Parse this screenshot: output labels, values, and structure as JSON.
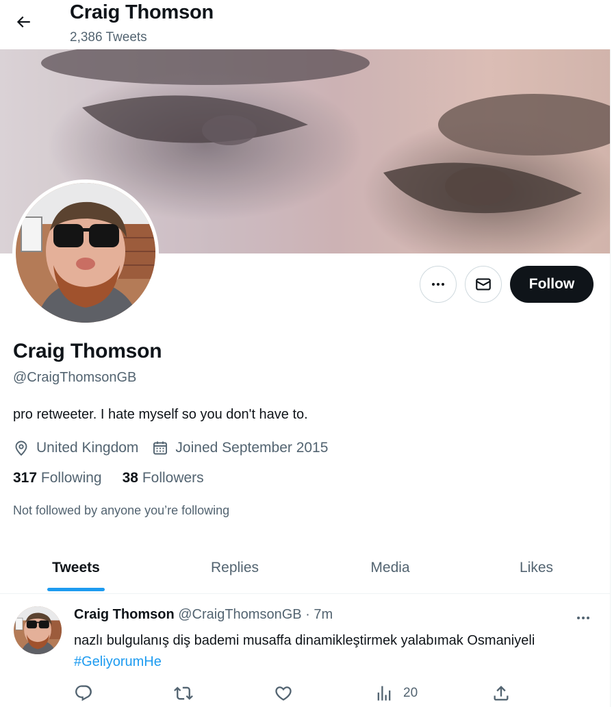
{
  "header": {
    "title": "Craig Thomson",
    "tweet_count": "2,386 Tweets"
  },
  "profile": {
    "display_name": "Craig Thomson",
    "handle": "@CraigThomsonGB",
    "bio": "pro retweeter. I hate myself so you don't have to.",
    "location": "United Kingdom",
    "joined": "Joined September 2015",
    "following_count": "317",
    "following_label": "Following",
    "followers_count": "38",
    "followers_label": "Followers",
    "not_followed_note": "Not followed by anyone you’re following"
  },
  "actions": {
    "more_icon": "more-horizontal-icon",
    "message_icon": "envelope-icon",
    "follow_label": "Follow"
  },
  "tabs": [
    {
      "label": "Tweets",
      "active": true
    },
    {
      "label": "Replies",
      "active": false
    },
    {
      "label": "Media",
      "active": false
    },
    {
      "label": "Likes",
      "active": false
    }
  ],
  "tweet": {
    "author_name": "Craig Thomson",
    "author_handle": "@CraigThomsonGB",
    "separator": "·",
    "time": "7m",
    "text": "nazlı bulgulanış diş bademi musaffa dinamikleştirmek yalabımak Osmaniyeli",
    "hashtag": "#GeliyorumHe",
    "views_count": "20"
  },
  "colors": {
    "accent": "#1d9bf0",
    "text_primary": "#0f1419",
    "text_secondary": "#536471",
    "follow_button_bg": "#0f1419",
    "border": "#cfd9de"
  }
}
